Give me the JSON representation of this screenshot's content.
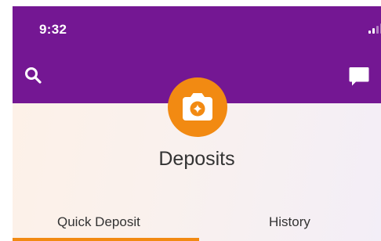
{
  "status_bar": {
    "time": "9:32",
    "icons": [
      "signal-icon",
      "wifi-icon",
      "battery-icon"
    ]
  },
  "header": {
    "background_color": "#741793",
    "left_action_icon": "search-icon",
    "right_action_icon": "message-icon",
    "center_badge_icon": "camera-icon",
    "badge_color": "#f28a12"
  },
  "page": {
    "title": "Deposits"
  },
  "tabs": [
    {
      "label": "Quick Deposit",
      "selected": true
    },
    {
      "label": "History",
      "selected": false
    }
  ],
  "colors": {
    "accent": "#f28a12",
    "text": "#333333"
  }
}
